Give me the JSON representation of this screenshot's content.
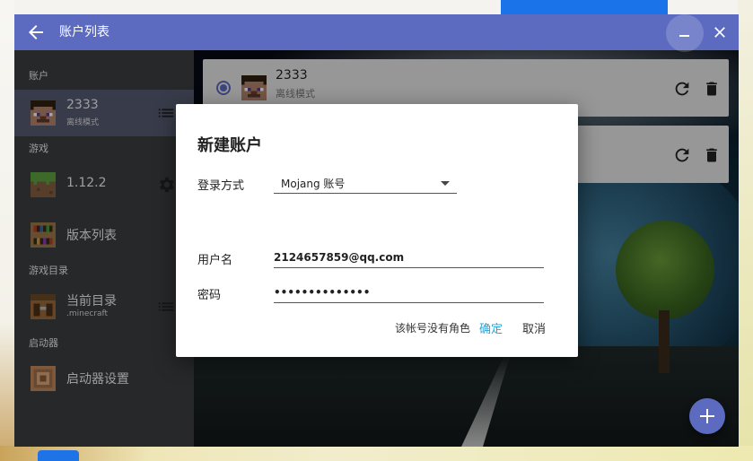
{
  "window": {
    "title": "账户列表"
  },
  "sidebar": {
    "sections": {
      "account": "账户",
      "game": "游戏",
      "game_dir": "游戏目录",
      "launcher": "启动器"
    },
    "items": {
      "account": {
        "label": "2333",
        "sub": "离线模式"
      },
      "version": {
        "label": "1.12.2"
      },
      "version_list": {
        "label": "版本列表"
      },
      "current_dir": {
        "label": "当前目录",
        "sub": ".minecraft"
      },
      "launcher_settings": {
        "label": "启动器设置"
      }
    }
  },
  "accounts": [
    {
      "name": "2333",
      "mode": "离线模式",
      "selected": true
    },
    {
      "name": "",
      "mode": "",
      "selected": false
    }
  ],
  "dialog": {
    "title": "新建账户",
    "login_method_label": "登录方式",
    "login_method_value": "Mojang 账号",
    "username_label": "用户名",
    "username_value": "2124657859@qq.com",
    "password_label": "密码",
    "password_value": "••••••••••••••",
    "hint": "该帐号没有角色",
    "ok_label": "确定",
    "cancel_label": "取消"
  },
  "colors": {
    "accent": "#5c6bc0",
    "link": "#29a3d9"
  }
}
